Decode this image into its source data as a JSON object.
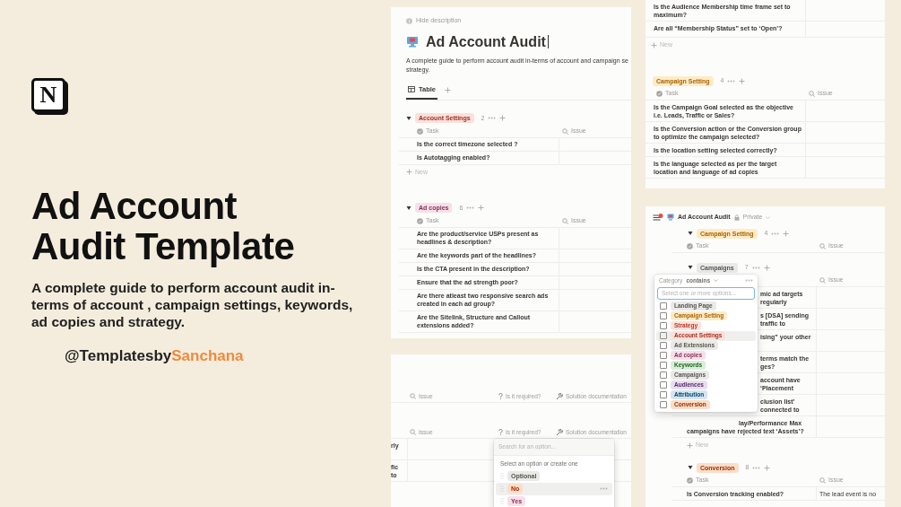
{
  "hero": {
    "logo_letter": "N",
    "title": "Ad Account Audit Template",
    "subtitle": "A complete guide to perform account audit in-terms of account , campaign settings, keywords, ad copies and strategy.",
    "handle": "@Templatesby",
    "handle_highlight": "Sanchana"
  },
  "page_panel": {
    "hide_description": "Hide description",
    "title": "Ad Account Audit",
    "description_lines": [
      "A complete guide to perform account audit in-terms  of account and campaign se",
      "strategy."
    ],
    "views": [
      {
        "label": "Table",
        "selected": true
      }
    ],
    "groups": [
      {
        "name": "Account Settings",
        "color": "#fbe0dc",
        "count": "2",
        "expanded": true,
        "columns": [
          {
            "label": "Task",
            "kind": "title"
          },
          {
            "label": "Issue",
            "kind": "text"
          }
        ],
        "rows": [
          {
            "task": "Is the correct timezone selected ?"
          },
          {
            "task": "Is Autotagging enabled?"
          }
        ],
        "new_label": "New"
      },
      {
        "name": "Ad copies",
        "color": "#f5e0e9",
        "count": "6",
        "expanded": true,
        "columns": [
          {
            "label": "Task",
            "kind": "title"
          },
          {
            "label": "Issue",
            "kind": "text"
          }
        ],
        "rows": [
          {
            "task": "Are the product/service USPs present as headlines & description?"
          },
          {
            "task": "Are the keywords part of the headlines?"
          },
          {
            "task": "Is the CTA present in the description?"
          },
          {
            "task": "Ensure that the ad strength poor?"
          },
          {
            "task": "Are there atleast two responsive search ads created in each ad group?"
          },
          {
            "task": "Are the Sitelink, Structure and Callout extensions added?"
          }
        ]
      }
    ]
  },
  "options_panel": {
    "header_rows": [
      {
        "columns": [
          {
            "label": "Issue",
            "kind": "text"
          },
          {
            "label": "Is it required?",
            "kind": "select"
          },
          {
            "label": "Solution documentation",
            "kind": "tool"
          }
        ]
      },
      {
        "columns": [
          {
            "label": "Issue",
            "kind": "text"
          },
          {
            "label": "Is it required?",
            "kind": "select"
          },
          {
            "label": "Solution documentation",
            "kind": "tool"
          }
        ]
      }
    ],
    "rows": [
      {
        "task": "rly"
      },
      {
        "task": "fic to"
      }
    ],
    "dropdown": {
      "placeholder": "Search for an option...",
      "hint": "Select an option or create one",
      "options": [
        {
          "label": "Optional",
          "color": "#e9e9e7",
          "highlighted": false
        },
        {
          "label": "No",
          "color": "#fadec9",
          "highlighted": true
        },
        {
          "label": "Yes",
          "color": "#f5e0e9",
          "highlighted": false
        }
      ]
    }
  },
  "audience_panel": {
    "rows": [
      {
        "task": "Is the Audience Membership time frame set to maximum?"
      },
      {
        "task": "Are all “Membership Status” set to ‘Open’?"
      }
    ],
    "new_label": "New",
    "groups": [
      {
        "name": "Campaign Setting",
        "color": "#fdecc8",
        "count": "4",
        "columns": [
          {
            "label": "Task",
            "kind": "title"
          },
          {
            "label": "Issue",
            "kind": "text"
          }
        ],
        "rows": [
          {
            "task": "Is the Campaign Goal selected as the objective i.e. Leads, Traffic or Sales?"
          },
          {
            "task": "Is the Conversion action or the Conversion group to optimize the campaign selected?"
          },
          {
            "task": "Is the location setting selected correctly?"
          },
          {
            "task": "Is the language selected as per the target location and language of ad copies"
          }
        ]
      }
    ]
  },
  "filter_panel": {
    "page_title": "Ad Account Audit",
    "privacy": "Private",
    "groups": [
      {
        "name": "Campaign Setting",
        "color": "#fdecc8",
        "count": "4",
        "expanded": true,
        "columns": [
          {
            "label": "Task",
            "kind": "title"
          },
          {
            "label": "Issue",
            "kind": "text"
          }
        ]
      },
      {
        "name": "Campaigns",
        "color": "#e9e9e7",
        "count": "7",
        "expanded": true,
        "columns": [
          {
            "label": "Issue",
            "kind": "text"
          }
        ],
        "rows": [
          {
            "task": "mic ad targets regularly",
            "kind": "covered"
          },
          {
            "task": "s [DSA] sending traffic to",
            "kind": "covered"
          },
          {
            "task": "ising” your other",
            "kind": "covered"
          },
          {
            "task": "terms match the ges?",
            "kind": "covered"
          },
          {
            "task": "account have ‘Placement",
            "kind": "covered"
          },
          {
            "task": "clusion list’ connected to",
            "kind": "covered"
          },
          {
            "task": "lay/Performance Max campaigns have rejected text ‘Assets’?",
            "kind": "partly"
          }
        ],
        "new_label": "New"
      },
      {
        "name": "Conversion",
        "color": "#fadec9",
        "count": "8",
        "expanded": true,
        "columns": [
          {
            "label": "Task",
            "kind": "title"
          },
          {
            "label": "Issue",
            "kind": "text"
          }
        ],
        "rows": [
          {
            "task": "Is Conversion tracking enabled?",
            "issue": "The lead event is  no"
          }
        ]
      }
    ],
    "filter": {
      "property": "Category",
      "operator": "contains",
      "placeholder": "Select one or more options...",
      "options": [
        {
          "label": "Landing Page",
          "color": "#e9e9e7",
          "checked": false,
          "highlighted": false
        },
        {
          "label": "Campaign Setting",
          "color": "#fdecc8",
          "checked": false,
          "highlighted": false
        },
        {
          "label": "Strategy",
          "color": "#ffe2dd",
          "checked": false,
          "highlighted": false
        },
        {
          "label": "Account Settings",
          "color": "#fbe0dc",
          "checked": false,
          "highlighted": true
        },
        {
          "label": "Ad Extensions",
          "color": "#e9e9e7",
          "checked": false,
          "highlighted": false
        },
        {
          "label": "Ad copies",
          "color": "#f5e0e9",
          "checked": false,
          "highlighted": false
        },
        {
          "label": "Keywords",
          "color": "#dbeddb",
          "checked": false,
          "highlighted": false
        },
        {
          "label": "Campaigns",
          "color": "#e9e9e7",
          "checked": false,
          "highlighted": false
        },
        {
          "label": "Audiences",
          "color": "#e8deee",
          "checked": false,
          "highlighted": false
        },
        {
          "label": "Attribution",
          "color": "#d3e5ef",
          "checked": false,
          "highlighted": false
        },
        {
          "label": "Conversion",
          "color": "#fadec9",
          "checked": false,
          "highlighted": false
        }
      ]
    }
  }
}
